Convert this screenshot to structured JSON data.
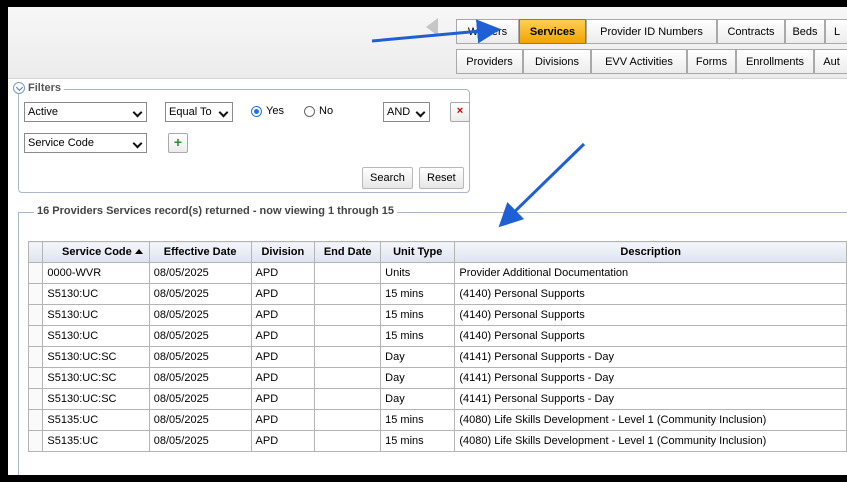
{
  "tabs_row1": [
    {
      "label": "Waivers",
      "active": false
    },
    {
      "label": "Services",
      "active": true
    },
    {
      "label": "Provider ID Numbers",
      "active": false
    },
    {
      "label": "Contracts",
      "active": false
    },
    {
      "label": "Beds",
      "active": false
    },
    {
      "label": "L",
      "active": false
    }
  ],
  "tabs_row2": [
    {
      "label": "Providers"
    },
    {
      "label": "Divisions"
    },
    {
      "label": "EVV Activities"
    },
    {
      "label": "Forms"
    },
    {
      "label": "Enrollments"
    },
    {
      "label": "Aut"
    }
  ],
  "filters": {
    "title": "Filters",
    "row1": {
      "field": "Active",
      "operator": "Equal To",
      "yes_label": "Yes",
      "no_label": "No",
      "selected": "Yes",
      "conjunction": "AND",
      "remove_symbol": "×"
    },
    "row2": {
      "field": "Service Code",
      "add_symbol": "+"
    },
    "search_label": "Search",
    "reset_label": "Reset"
  },
  "results": {
    "summary": "16 Providers Services record(s) returned - now viewing 1 through 15",
    "columns": [
      "Service Code",
      "Effective Date",
      "Division",
      "End Date",
      "Unit Type",
      "Description"
    ],
    "rows": [
      [
        "0000-WVR",
        "08/05/2025",
        "APD",
        "",
        "Units",
        "Provider Additional Documentation"
      ],
      [
        "S5130:UC",
        "08/05/2025",
        "APD",
        "",
        "15 mins",
        "(4140) Personal Supports"
      ],
      [
        "S5130:UC",
        "08/05/2025",
        "APD",
        "",
        "15 mins",
        "(4140) Personal Supports"
      ],
      [
        "S5130:UC",
        "08/05/2025",
        "APD",
        "",
        "15 mins",
        "(4140) Personal Supports"
      ],
      [
        "S5130:UC:SC",
        "08/05/2025",
        "APD",
        "",
        "Day",
        "(4141) Personal Supports - Day"
      ],
      [
        "S5130:UC:SC",
        "08/05/2025",
        "APD",
        "",
        "Day",
        "(4141) Personal Supports - Day"
      ],
      [
        "S5130:UC:SC",
        "08/05/2025",
        "APD",
        "",
        "Day",
        "(4141) Personal Supports - Day"
      ],
      [
        "S5135:UC",
        "08/05/2025",
        "APD",
        "",
        "15 mins",
        "(4080) Life Skills Development - Level 1 (Community Inclusion)"
      ],
      [
        "S5135:UC",
        "08/05/2025",
        "APD",
        "",
        "15 mins",
        "(4080) Life Skills Development - Level 1 (Community Inclusion)"
      ]
    ]
  },
  "colors": {
    "active_tab": "#f0a400",
    "annotation_arrow": "#1f5fd6",
    "remove_button": "#d00000",
    "add_button": "#2e8b2e"
  }
}
